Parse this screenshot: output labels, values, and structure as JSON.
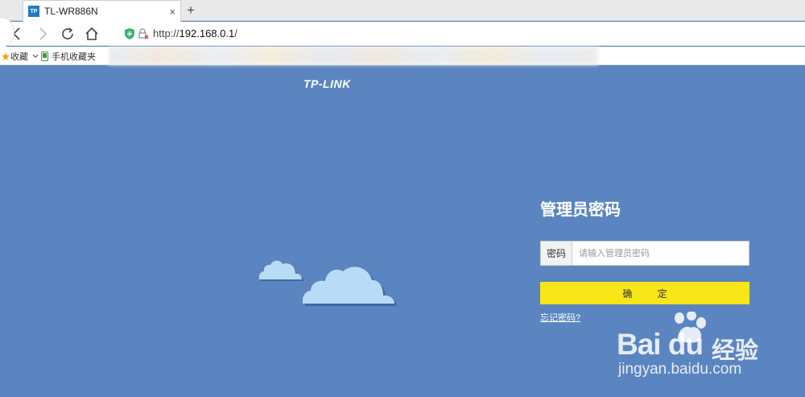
{
  "browser": {
    "tab_title": "TL-WR886N",
    "tab_favicon_text": "TP",
    "tab_close": "×",
    "new_tab": "+",
    "url_prefix": "http://",
    "url_host": "192.168.0.1",
    "url_suffix": "/",
    "bookmarks": [
      {
        "label": "收藏",
        "icon": "star-icon"
      },
      {
        "label": "手机收藏夹",
        "icon": "phone-icon"
      }
    ]
  },
  "page": {
    "background": "#5b85c0",
    "logo": "TP-LINK",
    "title": "管理员密码",
    "password_label": "密码",
    "password_placeholder": "请输入管理员密码",
    "confirm_button": "确 定",
    "forgot_link": "忘记密码?",
    "accent": "#f8e619"
  },
  "watermark": {
    "logo": "Bai du",
    "cn": "经验",
    "url": "jingyan.baidu.com"
  }
}
